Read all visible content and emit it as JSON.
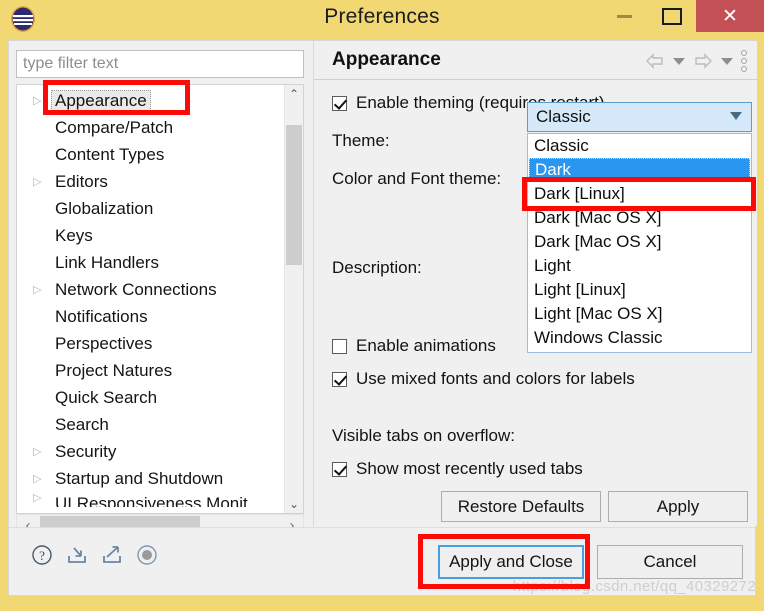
{
  "window": {
    "title": "Preferences",
    "app_icon": "eclipse-logo-icon",
    "accent_titlebar_color": "#f2d873",
    "close_button_color": "#c25055",
    "controls": {
      "minimize": "–",
      "maximize": "□",
      "close": "✕"
    }
  },
  "sidebar": {
    "filter": {
      "placeholder": "type filter text",
      "value": ""
    },
    "items": [
      {
        "label": "Appearance",
        "expandable": true,
        "selected": true
      },
      {
        "label": "Compare/Patch",
        "expandable": false,
        "selected": false
      },
      {
        "label": "Content Types",
        "expandable": false,
        "selected": false
      },
      {
        "label": "Editors",
        "expandable": true,
        "selected": false
      },
      {
        "label": "Globalization",
        "expandable": false,
        "selected": false
      },
      {
        "label": "Keys",
        "expandable": false,
        "selected": false
      },
      {
        "label": "Link Handlers",
        "expandable": false,
        "selected": false
      },
      {
        "label": "Network Connections",
        "expandable": true,
        "selected": false
      },
      {
        "label": "Notifications",
        "expandable": false,
        "selected": false
      },
      {
        "label": "Perspectives",
        "expandable": false,
        "selected": false
      },
      {
        "label": "Project Natures",
        "expandable": false,
        "selected": false
      },
      {
        "label": "Quick Search",
        "expandable": false,
        "selected": false
      },
      {
        "label": "Search",
        "expandable": false,
        "selected": false
      },
      {
        "label": "Security",
        "expandable": true,
        "selected": false
      },
      {
        "label": "Startup and Shutdown",
        "expandable": true,
        "selected": false
      },
      {
        "label": "UI Responsiveness Monit",
        "expandable": true,
        "selected": false
      }
    ],
    "scroll": {
      "up_arrow": "⌃",
      "down_arrow": "⌄",
      "left_arrow": "‹",
      "right_arrow": "›"
    }
  },
  "page": {
    "title": "Appearance",
    "toolbar": {
      "back_icon": "back-arrow-icon",
      "back_menu_icon": "chevron-down-icon",
      "forward_icon": "forward-arrow-icon",
      "forward_menu_icon": "chevron-down-icon",
      "menu_icon": "vertical-dots-menu-icon"
    },
    "enable_theming": {
      "label": "Enable theming (requires restart)",
      "checked": true
    },
    "theme": {
      "label": "Theme:",
      "value": "Classic",
      "expanded": true,
      "options": [
        "Classic",
        "Dark",
        "Dark [Linux]",
        "Dark [Mac OS X]",
        "Dark [Mac OS X]",
        "Light",
        "Light [Linux]",
        "Light [Mac OS X]",
        "Windows Classic"
      ],
      "highlighted_option": "Dark"
    },
    "color_font_theme": {
      "label": "Color and Font theme:"
    },
    "description": {
      "label": "Description:",
      "value": ""
    },
    "enable_animations": {
      "label": "Enable animations",
      "checked": false
    },
    "use_mixed_fonts": {
      "label": "Use mixed fonts and colors for labels",
      "checked": true
    },
    "visible_tabs": {
      "label": "Visible tabs on overflow:"
    },
    "show_mru_tabs": {
      "label": "Show most recently used tabs",
      "checked": true
    },
    "restore_defaults_label": "Restore Defaults",
    "apply_label": "Apply"
  },
  "footer": {
    "icons": [
      "help-icon",
      "import-preferences-icon",
      "export-preferences-icon",
      "record-icon"
    ],
    "apply_and_close_label": "Apply and Close",
    "cancel_label": "Cancel"
  },
  "annotations": {
    "color": "#fb0a06",
    "boxes": [
      "sidebar-appearance-item",
      "theme-dropdown-dark-option",
      "apply-and-close-button"
    ]
  },
  "watermark": "https://blog.csdn.net/qq_40329272"
}
